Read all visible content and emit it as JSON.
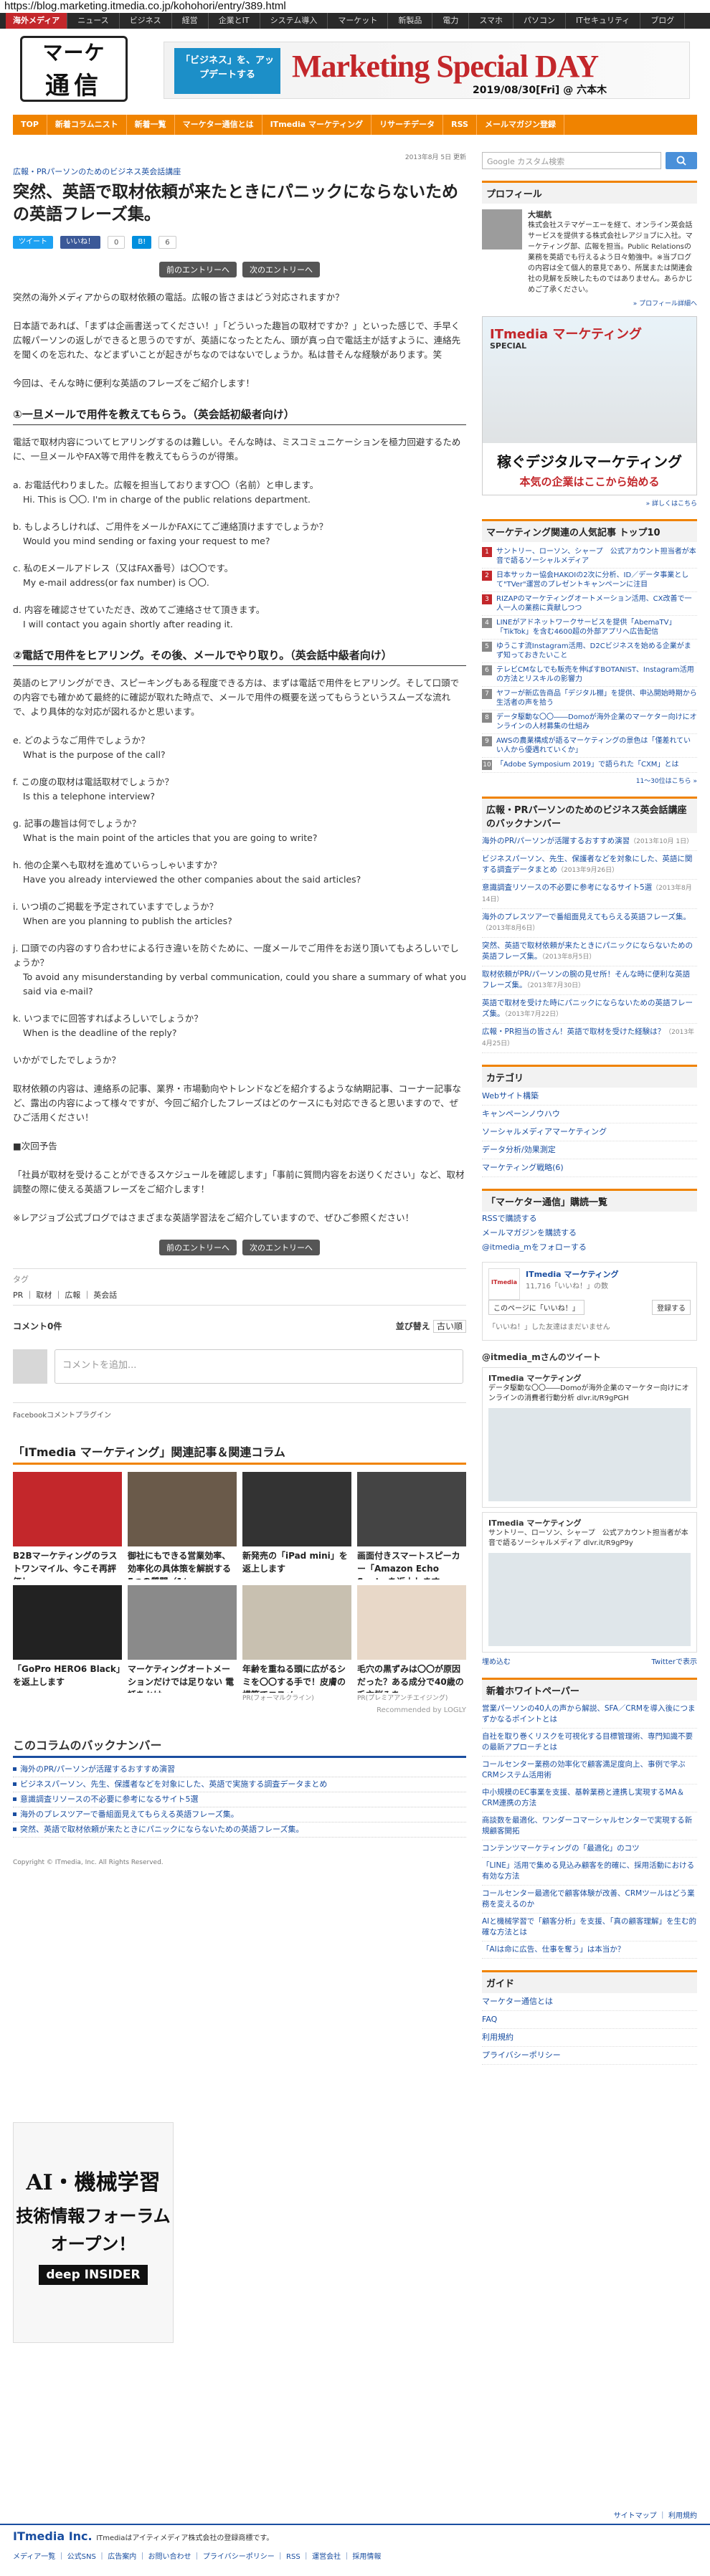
{
  "url": "https://blog.marketing.itmedia.co.jp/kohohori/entry/389.html",
  "netbar": [
    "海外メディア",
    "ニュース",
    "ビジネス",
    "経営",
    "企業とIT",
    "システム導入",
    "マーケット",
    "新製品",
    "電力",
    "スマホ",
    "パソコン",
    "ITセキュリティ",
    "ブログ"
  ],
  "logo": {
    "line1": "マーケ",
    "line2": "通信"
  },
  "banner": {
    "left": "「ビジネス」を、アップデートする",
    "title": "Marketing Special DAY",
    "date": "2019/08/30[Fri] @ 六本木"
  },
  "nav": [
    "TOP",
    "新着コラムニスト",
    "新着一覧",
    "マーケター通信とは",
    "ITmedia マーケティング",
    "リサーチデータ",
    "RSS",
    "メールマガジン登録"
  ],
  "article": {
    "date": "2013年8月 5日 更新",
    "series": "広報・PRパーソンのためのビジネス英会話講座",
    "title": "突然、英語で取材依頼が来たときにパニックにならないための英語フレーズ集。",
    "share": {
      "tweet": "ツイート",
      "like": "いいね！",
      "like_count": "0",
      "hatena": "B!",
      "hatena_count": "6"
    },
    "prev": "前のエントリーへ",
    "next": "次のエントリーへ",
    "p1": "突然の海外メディアからの取材依頼の電話。広報の皆さまはどう対応されますか？",
    "p2": "日本語であれば、「まずは企画書送ってください！」「どういった趣旨の取材ですか？」といった感じで、手早く広報パーソンの返しができると思うのですが、英語になったとたん、頭が真っ白で電話主が話すように、連絡先を聞くのを忘れた、などまずいことが起きがちなのではないでしょうか。私は昔そんな経験があります。笑",
    "p3": "今回は、そんな時に便利な英語のフレーズをご紹介します！",
    "h1": "①一旦メールで用件を教えてもらう。（英会話初級者向け）",
    "p4": "電話で取材内容についてヒアリングするのは難しい。そんな時は、ミスコミュニケーションを極力回避するために、一旦メールやFAX等で用件を教えてもらうのが得策。",
    "qa1": [
      {
        "jp": "a. お電話代わりました。広報を担当しております〇〇（名前）と申します。",
        "en": "Hi. This is 〇〇. I'm in charge of the public relations department."
      },
      {
        "jp": "b. もしよろしければ、ご用件をメールかFAXにてご連絡頂けますでしょうか？",
        "en": "Would you mind sending or faxing your request to me?"
      },
      {
        "jp": "c. 私のEメールアドレス（又はFAX番号）は〇〇です。",
        "en": "My e-mail address(or fax number) is 〇〇."
      },
      {
        "jp": "d. 内容を確認させていただき、改めてご連絡させて頂きます。",
        "en": "I will contact you again shortly after reading it."
      }
    ],
    "h2": "②電話で用件をヒアリング。その後、メールでやり取り。（英会話中級者向け）",
    "p5": "英語のヒアリングができ、スピーキングもある程度できる方は、まずは電話で用件をヒアリング。そして口頭での内容でも確かめて最終的に確認が取れた時点で、メールで用件の概要を送ってもらうというスムーズな流れで、より具体的な対応が図れるかと思います。",
    "qa2": [
      {
        "jp": "e. どのようなご用件でしょうか？",
        "en": "What is the purpose of the call?"
      },
      {
        "jp": "f. この度の取材は電話取材でしょうか？",
        "en": "Is this a telephone interview?"
      },
      {
        "jp": "g. 記事の趣旨は何でしょうか？",
        "en": "What is the main point of the articles that you are going to write?"
      },
      {
        "jp": "h. 他の企業へも取材を進めていらっしゃいますか？",
        "en": "Have you already interviewed the other companies about the said articles?"
      },
      {
        "jp": "i. いつ頃のご掲載を予定されていますでしょうか？",
        "en": "When are you planning to publish the articles?"
      },
      {
        "jp": "j. 口頭での内容のすり合わせによる行き違いを防ぐために、一度メールでご用件をお送り頂いてもよろしいでしょうか？",
        "en": "To avoid any misunderstanding by verbal communication, could you share a summary of what you said via e-mail?"
      },
      {
        "jp": "k. いつまでに回答すればよろしいでしょうか？",
        "en": "When is the deadline of the reply?"
      }
    ],
    "p6": "いかがでしたでしょうか？",
    "p7": "取材依頼の内容は、連絡系の記事、業界・市場動向やトレンドなどを紹介するような納期記事、コーナー記事など、露出の内容によって様々ですが、今回ご紹介したフレーズはどのケースにも対応できると思いますので、ぜひご活用ください！",
    "next_head": "■次回予告",
    "p8": "「社員が取材を受けることができるスケジュールを確認します」「事前に質問内容をお送りください」など、取材調整の際に使える英語フレーズをご紹介します！",
    "p9": "※レアジョブ公式ブログではさまざまな英語学習法をご紹介していますので、ぜひご参照ください！",
    "tags_head": "タグ",
    "tags": "PR ｜ 取材 ｜ 広報 ｜ 英会話"
  },
  "comments": {
    "count": "コメント0件",
    "sort": "並び替え",
    "sort_value": "古い順",
    "placeholder": "コメントを追加...",
    "plugin": "Facebookコメントプラグイン"
  },
  "related": {
    "title": "「ITmedia マーケティング」関連記事＆関連コラム",
    "cards": [
      {
        "cap": "B2Bマーケティングのラストワンマイル、今こそ再評価し",
        "src": "",
        "color": "#c3272b"
      },
      {
        "cap": "御社にもできる営業効率、効率化の具体策を解説する5つの質問（1/",
        "src": "",
        "color": "#6a5a4a"
      },
      {
        "cap": "新発売の「iPad mini」を返上します",
        "src": "",
        "color": "#333"
      },
      {
        "cap": "画面付きスマートスピーカー「Amazon Echo Spot」を返上します",
        "src": "",
        "color": "#444"
      },
      {
        "cap": "「GoPro HERO6 Black」を返上します",
        "src": "",
        "color": "#222"
      },
      {
        "cap": "マーケティングオートメーションだけでは足りない 電話をかけ、",
        "src": "",
        "color": "#8a8a8a"
      },
      {
        "cap": "年齢を重ねる頭に広がるシミを〇〇する手で！皮膚の構築でコスメ",
        "src": "PR(フォーマルクライン)",
        "color": "#c8c0b0"
      },
      {
        "cap": "毛穴の黒ずみは〇〇が原因だった？ある成分で40歳の毛穴悩みを",
        "src": "PR(プレミアアンチエイジング)",
        "color": "#e8d8c8"
      }
    ],
    "recommended": "Recommended by LOGLY"
  },
  "backnumber": {
    "title": "このコラムのバックナンバー",
    "items": [
      "海外のPR/パーソンが活躍するおすすめ演習",
      "ビジネスパーソン、先生、保護者などを対象にした、英語で実施する調査データまとめ",
      "意識調査リソースの不必要に参考になるサイト5選",
      "海外のプレスツアーで番組面見えてもらえる英語フレーズ集。",
      "突然、英語で取材依頼が来たときにパニックにならないための英語フレーズ集。"
    ]
  },
  "copyright": "Copyright © ITmedia, Inc. All Rights Reserved.",
  "leftAd": {
    "l1": "AI・機械学習",
    "l2": "技術情報フォーラム",
    "l3": "オープン！",
    "l4": "deep INSIDER"
  },
  "side": {
    "search_placeholder": "Google カスタム検索",
    "profile_head": "プロフィール",
    "profile_name": "大堀航",
    "profile_text": "株式会社ステマゲーエーを経て、オンライン英会話サービスを提供する株式会社レアジョブに入社。マーケティング部、広報を担当。Public Relationsの業務を英語でも行えるよう日々勉強中。※当ブログの内容は全て個人的意見であり、所属または関連会社の見解を反映したものではありません。あらかじめご了承ください。",
    "profile_more": "» プロフィール詳細へ",
    "ad": {
      "t1": "ITmedia マーケティング",
      "t2": "SPECIAL",
      "m": "稼ぐデジタルマーケティング",
      "s": "本気の企業はここから始める",
      "more": "» 詳しくはこちら"
    },
    "rank_head": "マーケティング関連の人気記事 トップ10",
    "rank": [
      "サントリー、ローソン、シャープ　公式アカウント担当者が本音で語るソーシャルメディア",
      "日本サッカー協会HAKOIの2次に分析、ID／データ事業として\"TVer\"運営のプレゼントキャンペーンに注目",
      "RIZAPのマーケティングオートメーション活用、CX改善で一人一人の業務に貢献しつつ",
      "LINEがアドネットワークサービスを提供「AbemaTV」「TikTok」を含む4600超の外部アプリへ広告配信",
      "ゆうこす流Instagram活用、D2Cビジネスを始める企業がまず知っておきたいこと",
      "テレビCMなしでも販売を伸ばすBOTANIST、Instagram活用の方法とリスキルの影響力",
      "ヤフーが新広告商品「デジタル棚」を提供、申込開始時期から生活者の声を拾う",
      "データ駆動な〇〇――Domoが海外企業のマーケター向けにオンラインの人材募集の仕組み",
      "AWSの農業構成が語るマーケティングの景色は「僅差れていい人から優遇れていくか」",
      "「Adobe Symposium 2019」で語られた「CXM」とは"
    ],
    "rank_more": "11〜30位はこちら »",
    "series_head": "広報・PRパーソンのためのビジネス英会話講座のバックナンバー",
    "series_list": [
      {
        "t": "海外のPR/パーソンが活躍するおすすめ演習",
        "d": "（2013年10月 1日）"
      },
      {
        "t": "ビジネスパーソン、先生、保護者などを対象にした、英語に関する調査データまとめ",
        "d": "（2013年9月26日）"
      },
      {
        "t": "意識調査リソースの不必要に参考になるサイト5選",
        "d": "（2013年8月14日）"
      },
      {
        "t": "海外のプレスツアーで番組面見えてもらえる英語フレーズ集。",
        "d": "（2013年8月6日）"
      },
      {
        "t": "突然、英語で取材依頼が来たときにパニックにならないための英語フレーズ集。",
        "d": "（2013年8月5日）"
      },
      {
        "t": "取材依頼がPR/パーソンの腕の見せ所！そんな時に便利な英語フレーズ集。",
        "d": "（2013年7月30日）"
      },
      {
        "t": "英語で取材を受けた時にパニックにならないための英語フレーズ集。",
        "d": "（2013年7月22日）"
      },
      {
        "t": "広報・PR担当の皆さん！英語で取材を受けた経験は？",
        "d": "（2013年4月25日）"
      }
    ],
    "cat_head": "カテゴリ",
    "cats": [
      "Webサイト構築",
      "キャンペーンノウハウ",
      "ソーシャルメディアマーケティング",
      "データ分析/効果測定",
      "マーケティング戦略(6)"
    ],
    "sub_head": "「マーケター通信」購読一覧",
    "subs": [
      "RSSで購読する",
      "メールマガジンを購読する",
      "@itmedia_mをフォローする"
    ],
    "fb_name": "ITmedia マーケティング",
    "fb_count": "11,716「いいね！」の数",
    "fb_like": "このページに「いいね！」",
    "fb_signup": "登録する",
    "fb_note": "「いいね！」した友達はまだいません",
    "tweets_head": "@itmedia_mさんのツイート",
    "tweets": [
      {
        "h": "ITmedia マーケティング",
        "t": "データ駆動な〇〇――Domoが海外企業のマーケター向けにオンラインの消費者行動分析 dlvr.it/R9gPGH"
      },
      {
        "h": "ITmedia マーケティング",
        "t": "サントリー、ローソン、シャープ　公式アカウント担当者が本音で語るソーシャルメディア dlvr.it/R9gP9y"
      }
    ],
    "tweet_embed": "埋め込む",
    "tweet_view": "Twitterで表示",
    "wp_head": "新着ホワイトペーパー",
    "wp": [
      "営業パーソンの40人の声から解説、SFA／CRMを導入後につまずかなるポイントとは",
      "自社を取り巻くリスクを可視化する目標管理術、専門知識不要の最新アプローチとは",
      "コールセンター業務の効率化で顧客満足度向上、事例で学ぶCRMシステム活用術",
      "中小規模のEC事業を支援、基幹業務と連携し実現するMA＆CRM連携の方法",
      "商談数を最適化、ワンダーコマーシャルセンターで実現する新規顧客開拓",
      "コンテンツマーケティングの「最適化」のコツ",
      "「LINE」活用で集める見込み顧客を的確に、採用活動における有効な方法",
      "コールセンター最適化で顧客体験が改善、CRMツールはどう業務を変えるのか",
      "AIと機械学習で「顧客分析」を支援、「真の顧客理解」を生む的確な方法とは",
      "「AIは命に広告、仕事を奪う」は本当か？"
    ],
    "guide_head": "ガイド",
    "guide": [
      "マーケター通信とは",
      "FAQ",
      "利用規約",
      "プライバシーポリシー"
    ]
  },
  "footer": {
    "brand": "ITmedia Inc.",
    "sub": "ITmediaはアイティメディア株式会社の登録商標です。",
    "links": "メディア一覧 ｜ 公式SNS ｜ 広告案内 ｜ お問い合わせ ｜ プライバシーポリシー ｜ RSS ｜ 運営会社 ｜ 採用情報",
    "top": "サイトマップ ｜ 利用規約"
  }
}
